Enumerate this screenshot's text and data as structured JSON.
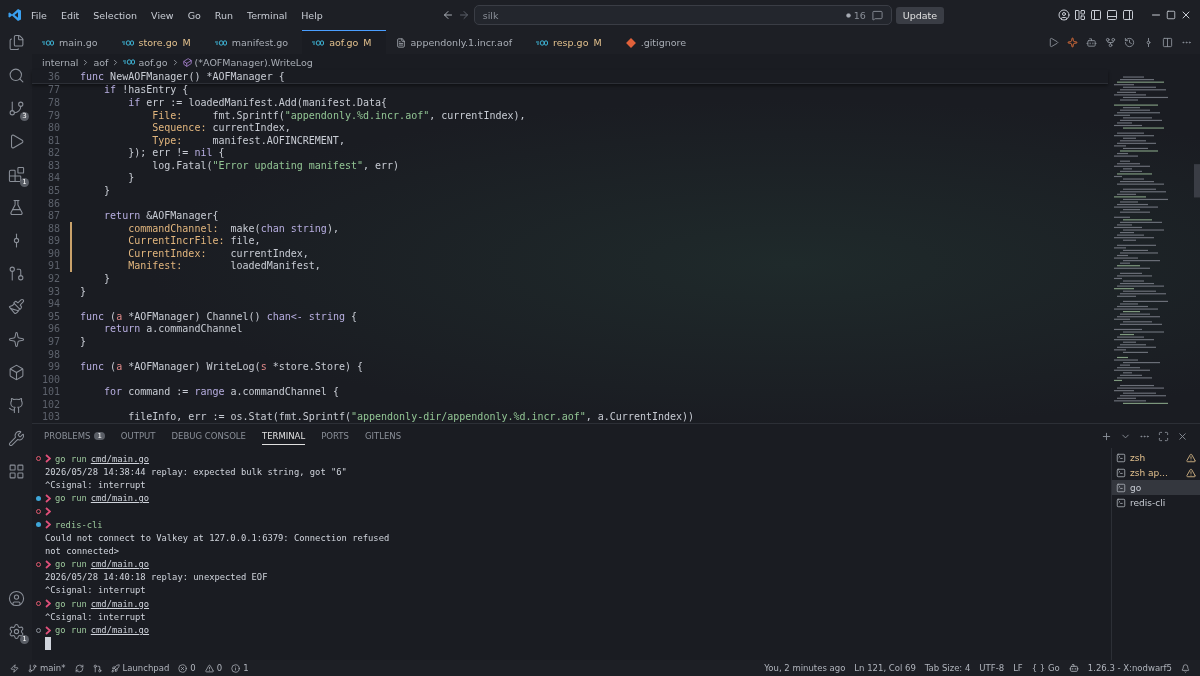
{
  "menu": [
    "File",
    "Edit",
    "Selection",
    "View",
    "Go",
    "Run",
    "Terminal",
    "Help"
  ],
  "search": {
    "value": "silk",
    "count": "16"
  },
  "update_button": "Update",
  "activity": [
    {
      "kind": "files"
    },
    {
      "kind": "search"
    },
    {
      "kind": "scm",
      "badge": "3"
    },
    {
      "kind": "debug"
    },
    {
      "kind": "extensions",
      "badge": "1"
    },
    {
      "kind": "testing"
    },
    {
      "kind": "commit"
    },
    {
      "kind": "pr"
    },
    {
      "kind": "broom"
    },
    {
      "kind": "sparkle"
    },
    {
      "kind": "box"
    },
    {
      "kind": "github"
    },
    {
      "kind": "wrench"
    },
    {
      "kind": "layout"
    }
  ],
  "activity_bottom": [
    {
      "kind": "account"
    },
    {
      "kind": "settings",
      "badge": "1"
    }
  ],
  "tabs": [
    {
      "label": "main.go",
      "kind": "go",
      "selected": false
    },
    {
      "label": "store.go",
      "kind": "go",
      "mark": "M",
      "selected": false
    },
    {
      "label": "manifest.go",
      "kind": "go",
      "selected": false
    },
    {
      "label": "aof.go",
      "kind": "go",
      "mark": "M",
      "selected": true
    },
    {
      "label": "appendonly.1.incr.aof",
      "kind": "file",
      "selected": false
    },
    {
      "label": "resp.go",
      "kind": "go",
      "mark": "M",
      "selected": false
    },
    {
      "label": ".gitignore",
      "kind": "git",
      "selected": false
    }
  ],
  "breadcrumb": [
    "internal",
    "aof",
    "aof.go",
    "(*AOFManager).WriteLog"
  ],
  "sticky": {
    "number": "36",
    "tokens": [
      {
        "kind": "keyword",
        "text": "func "
      },
      {
        "kind": "plain",
        "text": "NewAOFManager() *AOFManager {"
      }
    ]
  },
  "code": [
    {
      "number": "77",
      "changed": false,
      "tokens": [
        {
          "kind": "keyword",
          "text": "    if "
        },
        {
          "kind": "plain",
          "text": "!hasEntry {"
        }
      ]
    },
    {
      "number": "78",
      "changed": false,
      "tokens": [
        {
          "kind": "keyword",
          "text": "        if "
        },
        {
          "kind": "plain",
          "text": "err := loadedManifest.Add(manifest.Data{"
        }
      ]
    },
    {
      "number": "79",
      "changed": false,
      "tokens": [
        {
          "kind": "field",
          "text": "            File:"
        },
        {
          "kind": "plain",
          "text": "     fmt.Sprintf("
        },
        {
          "kind": "string",
          "text": "\"appendonly.%d.incr.aof\""
        },
        {
          "kind": "plain",
          "text": ", currentIndex),"
        }
      ]
    },
    {
      "number": "80",
      "changed": false,
      "tokens": [
        {
          "kind": "field",
          "text": "            Sequence:"
        },
        {
          "kind": "plain",
          "text": " currentIndex,"
        }
      ]
    },
    {
      "number": "81",
      "changed": false,
      "tokens": [
        {
          "kind": "field",
          "text": "            Type:"
        },
        {
          "kind": "plain",
          "text": "     manifest.AOFINCREMENT,"
        }
      ]
    },
    {
      "number": "82",
      "changed": false,
      "tokens": [
        {
          "kind": "plain",
          "text": "        }); err != "
        },
        {
          "kind": "keyword",
          "text": "nil"
        },
        {
          "kind": "plain",
          "text": " {"
        }
      ]
    },
    {
      "number": "83",
      "changed": false,
      "tokens": [
        {
          "kind": "plain",
          "text": "            log.Fatal("
        },
        {
          "kind": "string",
          "text": "\"Error updating manifest\""
        },
        {
          "kind": "plain",
          "text": ", err)"
        }
      ]
    },
    {
      "number": "84",
      "changed": false,
      "tokens": [
        {
          "kind": "plain",
          "text": "        }"
        }
      ]
    },
    {
      "number": "85",
      "changed": false,
      "tokens": [
        {
          "kind": "plain",
          "text": "    }"
        }
      ]
    },
    {
      "number": "86",
      "changed": false
    },
    {
      "number": "87",
      "changed": false,
      "tokens": [
        {
          "kind": "keyword",
          "text": "    return "
        },
        {
          "kind": "plain",
          "text": "&AOFManager{"
        }
      ]
    },
    {
      "number": "88",
      "changed": true,
      "tokens": [
        {
          "kind": "field",
          "text": "        commandChannel:"
        },
        {
          "kind": "plain",
          "text": "  make("
        },
        {
          "kind": "keyword",
          "text": "chan string"
        },
        {
          "kind": "plain",
          "text": "),"
        }
      ]
    },
    {
      "number": "89",
      "changed": true,
      "tokens": [
        {
          "kind": "field",
          "text": "        CurrentIncrFile:"
        },
        {
          "kind": "plain",
          "text": " file,"
        }
      ]
    },
    {
      "number": "90",
      "changed": true,
      "tokens": [
        {
          "kind": "field",
          "text": "        CurrentIndex:"
        },
        {
          "kind": "plain",
          "text": "    currentIndex,"
        }
      ]
    },
    {
      "number": "91",
      "changed": true,
      "tokens": [
        {
          "kind": "field",
          "text": "        Manifest:"
        },
        {
          "kind": "plain",
          "text": "        loadedManifest,"
        }
      ]
    },
    {
      "number": "92",
      "changed": false,
      "tokens": [
        {
          "kind": "plain",
          "text": "    }"
        }
      ]
    },
    {
      "number": "93",
      "changed": false,
      "tokens": [
        {
          "kind": "plain",
          "text": "}"
        }
      ]
    },
    {
      "number": "94",
      "changed": false
    },
    {
      "number": "95",
      "changed": false,
      "tokens": [
        {
          "kind": "keyword",
          "text": "func "
        },
        {
          "kind": "plain",
          "text": "("
        },
        {
          "kind": "param",
          "text": "a"
        },
        {
          "kind": "plain",
          "text": " *AOFManager) Channel() "
        },
        {
          "kind": "keyword",
          "text": "chan<- string"
        },
        {
          "kind": "plain",
          "text": " {"
        }
      ]
    },
    {
      "number": "96",
      "changed": false,
      "tokens": [
        {
          "kind": "keyword",
          "text": "    return "
        },
        {
          "kind": "plain",
          "text": "a.commandChannel"
        }
      ]
    },
    {
      "number": "97",
      "changed": false,
      "tokens": [
        {
          "kind": "plain",
          "text": "}"
        }
      ]
    },
    {
      "number": "98",
      "changed": false
    },
    {
      "number": "99",
      "changed": false,
      "tokens": [
        {
          "kind": "keyword",
          "text": "func "
        },
        {
          "kind": "plain",
          "text": "("
        },
        {
          "kind": "param",
          "text": "a"
        },
        {
          "kind": "plain",
          "text": " *AOFManager) WriteLog("
        },
        {
          "kind": "param",
          "text": "s"
        },
        {
          "kind": "plain",
          "text": " *store.Store) {"
        }
      ]
    },
    {
      "number": "100",
      "changed": false
    },
    {
      "number": "101",
      "changed": false,
      "tokens": [
        {
          "kind": "keyword",
          "text": "    for "
        },
        {
          "kind": "plain",
          "text": "command := "
        },
        {
          "kind": "keyword",
          "text": "range "
        },
        {
          "kind": "plain",
          "text": "a.commandChannel {"
        }
      ]
    },
    {
      "number": "102",
      "changed": false
    },
    {
      "number": "103",
      "changed": false,
      "tokens": [
        {
          "kind": "plain",
          "text": "        fileInfo, err := os.Stat(fmt.Sprintf("
        },
        {
          "kind": "string",
          "text": "\"appendonly-dir/appendonly.%d.incr.aof\""
        },
        {
          "kind": "plain",
          "text": ", a.CurrentIndex))"
        }
      ]
    }
  ],
  "panel_tabs": [
    {
      "label": "PROBLEMS",
      "badge": "1",
      "selected": false
    },
    {
      "label": "OUTPUT",
      "selected": false
    },
    {
      "label": "DEBUG CONSOLE",
      "selected": false
    },
    {
      "label": "TERMINAL",
      "selected": true
    },
    {
      "label": "PORTS",
      "selected": false
    },
    {
      "label": "GITLENS",
      "selected": false
    }
  ],
  "terminal": [
    {
      "kind": "prompt",
      "done": true,
      "failed": true,
      "command": "go run",
      "argument": "cmd/main.go"
    },
    {
      "kind": "output",
      "text": "2026/05/28 14:38:44 replay: expected bulk string, got \"6\""
    },
    {
      "kind": "output",
      "text": "^Csignal: interrupt"
    },
    {
      "kind": "prompt",
      "done": true,
      "failed": false,
      "command": "go run",
      "argument": "cmd/main.go"
    },
    {
      "kind": "prompt",
      "done": true,
      "failed": true
    },
    {
      "kind": "prompt",
      "done": true,
      "failed": false,
      "command": "redis-cli"
    },
    {
      "kind": "output",
      "text": "Could not connect to Valkey at 127.0.0.1:6379: Connection refused"
    },
    {
      "kind": "output",
      "text": "not connected>"
    },
    {
      "kind": "prompt",
      "done": true,
      "failed": true,
      "command": "go run",
      "argument": "cmd/main.go"
    },
    {
      "kind": "output",
      "text": "2026/05/28 14:40:18 replay: unexpected EOF"
    },
    {
      "kind": "output",
      "text": "^Csignal: interrupt"
    },
    {
      "kind": "prompt",
      "done": true,
      "failed": true,
      "command": "go run",
      "argument": "cmd/main.go"
    },
    {
      "kind": "output",
      "text": "^Csignal: interrupt"
    },
    {
      "kind": "prompt",
      "done": false,
      "command": "go run",
      "argument": "cmd/main.go"
    },
    {
      "kind": "cursor"
    }
  ],
  "terminal_list": [
    {
      "label": "zsh",
      "warning": true,
      "selected": false
    },
    {
      "label": "zsh ap...",
      "warning": true,
      "selected": false
    },
    {
      "label": "go",
      "warning": false,
      "selected": true
    },
    {
      "label": "redis-cli",
      "warning": false,
      "selected": false
    }
  ],
  "status_left": {
    "branch": "main*",
    "launchpad": "Launchpad",
    "errors": "0",
    "warnings": "0",
    "infos": "1"
  },
  "status_right": [
    "You, 2 minutes ago",
    "Ln 121, Col 69",
    "Tab Size: 4",
    "UTF-8",
    "LF",
    "{ } Go",
    "1.26.3 - X:nodwarf5"
  ]
}
